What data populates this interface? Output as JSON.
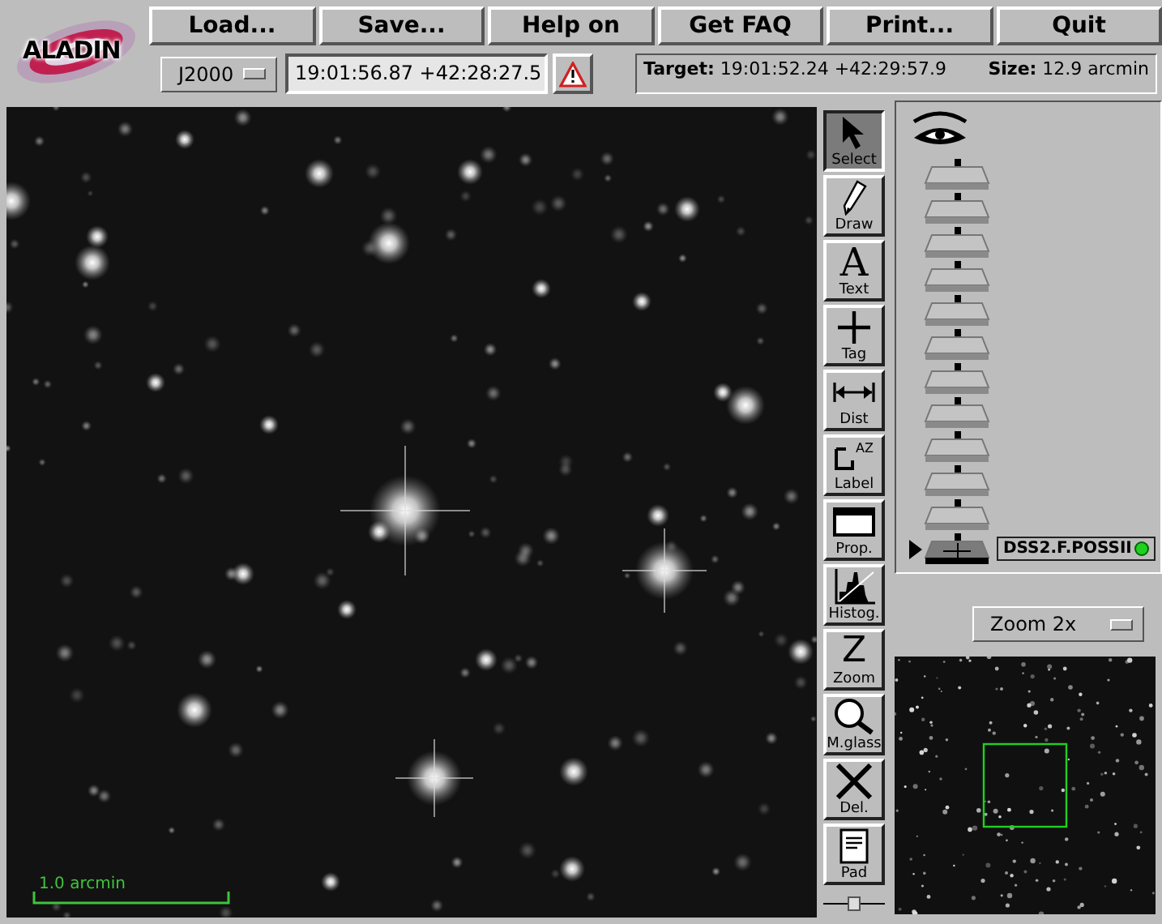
{
  "logo": {
    "text": "ALADIN"
  },
  "menu_buttons": [
    "Load...",
    "Save...",
    "Help on",
    "Get FAQ",
    "Print...",
    "Quit"
  ],
  "frame_select": {
    "value": "J2000"
  },
  "position_field": {
    "value": "19:01:56.87 +42:28:27.5"
  },
  "target": {
    "label": "Target:",
    "value": "19:01:52.24 +42:29:57.9"
  },
  "size": {
    "label": "Size:",
    "value": "12.9 arcmin"
  },
  "image_view": {
    "scale_label": "1.0 arcmin"
  },
  "tools": [
    {
      "label": "Select",
      "selected": true
    },
    {
      "label": "Draw",
      "selected": false
    },
    {
      "label": "Text",
      "glyph": "A",
      "selected": false
    },
    {
      "label": "Tag",
      "selected": false
    },
    {
      "label": "Dist",
      "selected": false
    },
    {
      "label": "Label",
      "glyph": "AZ",
      "selected": false
    },
    {
      "label": "Prop.",
      "selected": false
    },
    {
      "label": "Histog.",
      "selected": false
    },
    {
      "label": "Zoom",
      "glyph": "Z",
      "selected": false
    },
    {
      "label": "M.glass",
      "selected": false
    },
    {
      "label": "Del.",
      "selected": false
    },
    {
      "label": "Pad",
      "selected": false
    }
  ],
  "tool_slider": {
    "level": 0.5
  },
  "planes": [
    {
      "kind": "empty",
      "selected": false
    },
    {
      "kind": "empty",
      "selected": false
    },
    {
      "kind": "empty",
      "selected": false
    },
    {
      "kind": "empty",
      "selected": false
    },
    {
      "kind": "empty",
      "selected": false
    },
    {
      "kind": "empty",
      "selected": false
    },
    {
      "kind": "empty",
      "selected": false
    },
    {
      "kind": "empty",
      "selected": false
    },
    {
      "kind": "empty",
      "selected": false
    },
    {
      "kind": "empty",
      "selected": false
    },
    {
      "kind": "empty",
      "selected": false
    },
    {
      "kind": "image",
      "label": "DSS2.F.POSSII",
      "selected": true
    }
  ],
  "zoom_select": {
    "value": "Zoom 2x"
  }
}
